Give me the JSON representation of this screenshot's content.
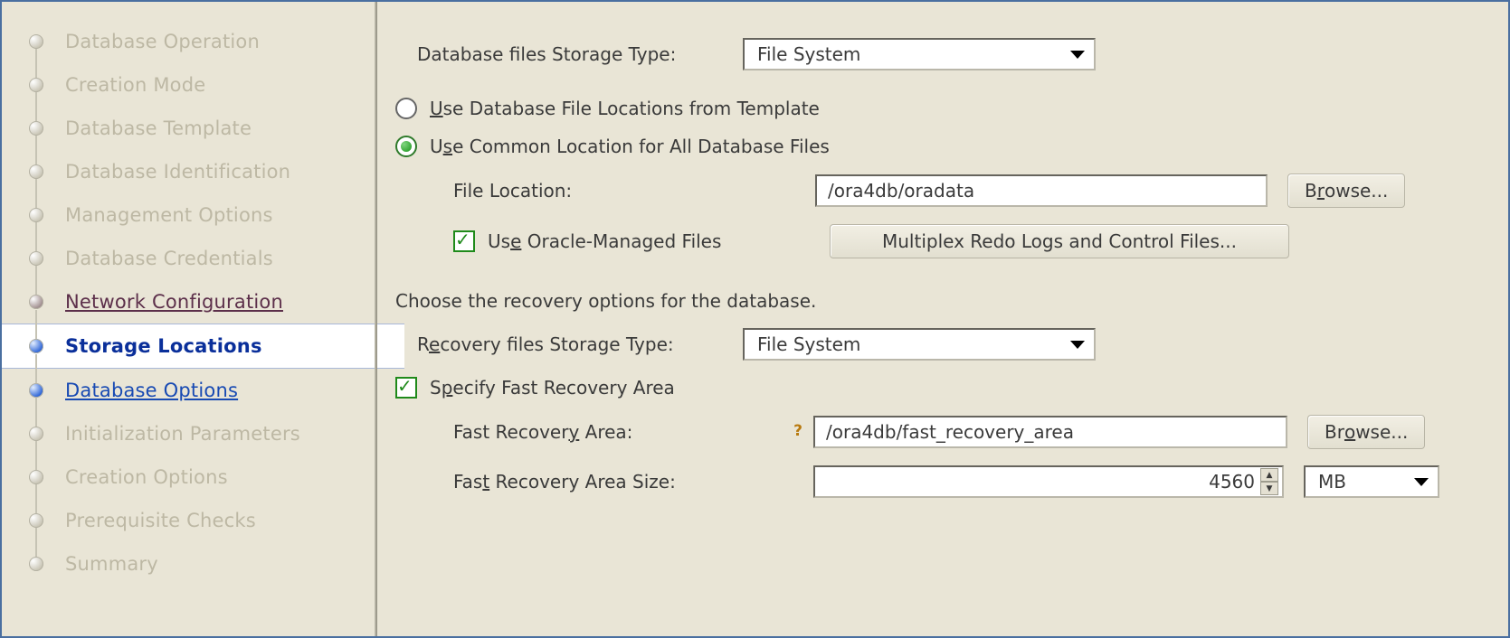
{
  "sidebar": {
    "steps": [
      {
        "label": "Database Operation",
        "state": "done"
      },
      {
        "label": "Creation Mode",
        "state": "done"
      },
      {
        "label": "Database Template",
        "state": "done"
      },
      {
        "label": "Database Identification",
        "state": "done"
      },
      {
        "label": "Management Options",
        "state": "done"
      },
      {
        "label": "Database Credentials",
        "state": "done"
      },
      {
        "label": "Network Configuration",
        "state": "visited"
      },
      {
        "label": "Storage Locations",
        "state": "current"
      },
      {
        "label": "Database Options",
        "state": "next"
      },
      {
        "label": "Initialization Parameters",
        "state": "done"
      },
      {
        "label": "Creation Options",
        "state": "done"
      },
      {
        "label": "Prerequisite Checks",
        "state": "done"
      },
      {
        "label": "Summary",
        "state": "done"
      }
    ]
  },
  "storage_type_label": "Database files Storage Type:",
  "storage_type_value": "File System",
  "radio_template_label": "Use Database File Locations from Template",
  "radio_common_label": "Use Common Location for All Database Files",
  "file_location_label": "File Location:",
  "file_location_value": "/ora4db/oradata",
  "browse_label": "Browse...",
  "omf_label": "Use Oracle-Managed Files",
  "multiplex_button_label": "Multiplex Redo Logs and Control Files...",
  "recovery_prompt": "Choose the recovery options for the database.",
  "recovery_type_label": "Recovery files Storage Type:",
  "recovery_type_value": "File System",
  "fra_checkbox_label": "Specify Fast Recovery Area",
  "fra_label": "Fast Recovery Area:",
  "fra_value": "/ora4db/fast_recovery_area",
  "fra_size_label": "Fast Recovery Area Size:",
  "fra_size_value": "4560",
  "fra_size_unit": "MB"
}
